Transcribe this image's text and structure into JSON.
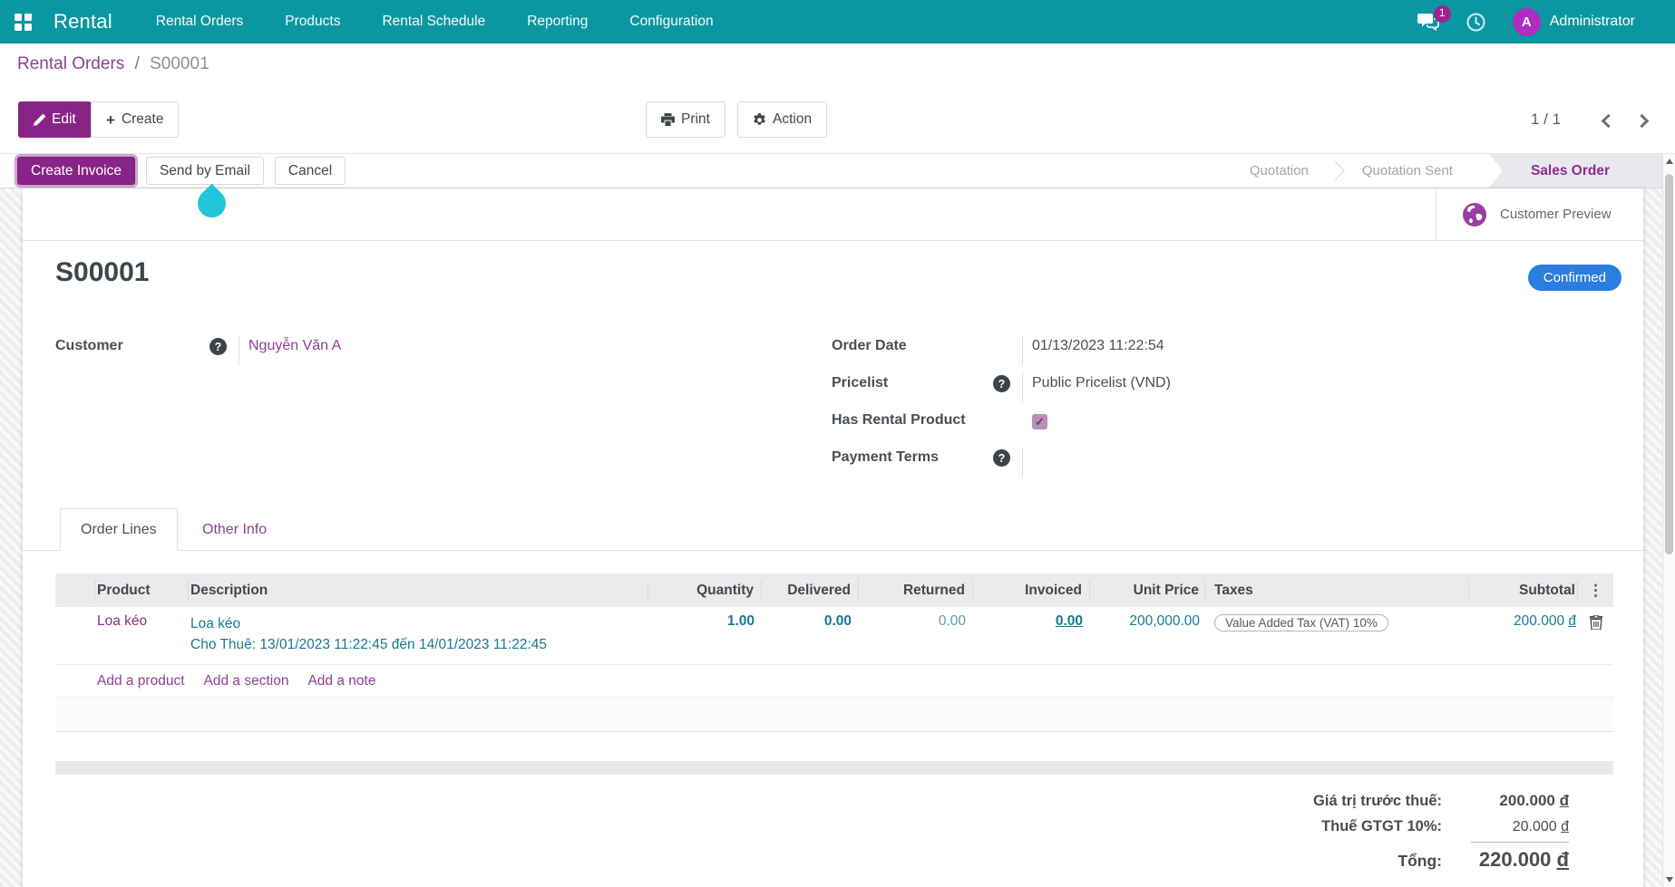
{
  "nav": {
    "brand": "Rental",
    "items": [
      "Rental Orders",
      "Products",
      "Rental Schedule",
      "Reporting",
      "Configuration"
    ],
    "messages_badge": "1",
    "user": {
      "name": "Administrator",
      "avatar_initial": "A"
    }
  },
  "breadcrumb": {
    "parent": "Rental Orders",
    "separator": "/",
    "current": "S00001"
  },
  "toolbar": {
    "edit_label": "Edit",
    "create_label": "Create",
    "print_label": "Print",
    "action_label": "Action",
    "pager": "1 / 1"
  },
  "statusbar": {
    "buttons": {
      "create_invoice": "Create Invoice",
      "send_by_email": "Send by Email",
      "cancel": "Cancel"
    },
    "steps": [
      {
        "label": "Quotation",
        "active": false
      },
      {
        "label": "Quotation Sent",
        "active": false
      },
      {
        "label": "Sales Order",
        "active": true
      }
    ]
  },
  "sheet": {
    "customer_preview_label": "Customer Preview",
    "title": "S00001",
    "status_badge": "Confirmed",
    "fields_left": {
      "customer": {
        "label": "Customer",
        "value": "Nguyễn Văn A"
      }
    },
    "fields_right": {
      "order_date": {
        "label": "Order Date",
        "value": "01/13/2023 11:22:54"
      },
      "pricelist": {
        "label": "Pricelist",
        "value": "Public Pricelist (VND)"
      },
      "has_rental_product": {
        "label": "Has Rental Product",
        "checked": true
      },
      "payment_terms": {
        "label": "Payment Terms",
        "value": ""
      }
    },
    "tabs": [
      {
        "label": "Order Lines",
        "active": true
      },
      {
        "label": "Other Info",
        "active": false
      }
    ],
    "table": {
      "columns": [
        "",
        "Product",
        "Description",
        "Quantity",
        "Delivered",
        "Returned",
        "Invoiced",
        "Unit Price",
        "Taxes",
        "Subtotal"
      ],
      "rows": [
        {
          "product": "Loa kéo",
          "description_lines": [
            "Loa kéo",
            "Cho Thuê: 13/01/2023 11:22:45 đến 14/01/2023 11:22:45"
          ],
          "quantity": "1.00",
          "delivered": "0.00",
          "returned": "0.00",
          "invoiced": "0.00",
          "unit_price": "200,000.00",
          "taxes": "Value Added Tax (VAT) 10%",
          "subtotal_amount": "200.000",
          "currency": "đ"
        }
      ],
      "links": [
        "Add a product",
        "Add a section",
        "Add a note"
      ]
    },
    "totals": {
      "untaxed": {
        "label": "Giá trị trước thuế:",
        "amount": "200.000",
        "currency": "đ"
      },
      "tax": {
        "label": "Thuế GTGT 10%:",
        "amount": "20.000",
        "currency": "đ"
      },
      "total": {
        "label": "Tổng:",
        "amount": "220.000",
        "currency": "đ"
      }
    }
  },
  "colors": {
    "nav_teal": "#0b97a1",
    "primary_purple": "#8a2387",
    "link_purple": "#8f3f92",
    "status_badge_blue": "#2b7de0",
    "data_teal": "#17798f",
    "droplet_cyan": "#1fc6da",
    "avatar_magenta": "#b02cc0"
  }
}
